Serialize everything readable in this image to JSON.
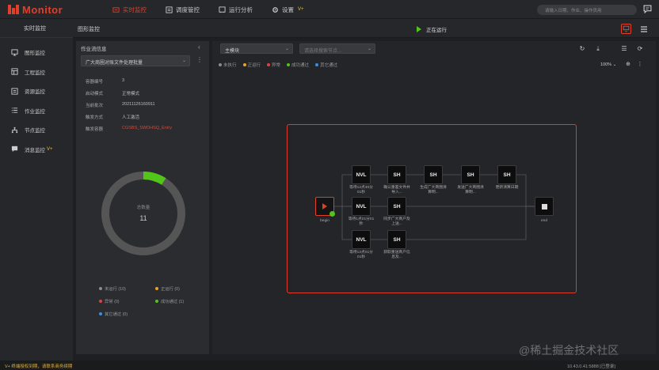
{
  "app": {
    "title": "Monitor"
  },
  "nav": [
    {
      "label": "实时监控",
      "badge": ""
    },
    {
      "label": "调度管控",
      "badge": ""
    },
    {
      "label": "运行分析",
      "badge": ""
    },
    {
      "label": "设置",
      "badge": "V+"
    }
  ],
  "search": {
    "placeholder": "请输入日期、作业、操作员用"
  },
  "sidebar": {
    "header": "实时监控",
    "items": [
      {
        "label": "图形监控",
        "icon": "monitor-icon",
        "badge": ""
      },
      {
        "label": "工程监控",
        "icon": "project-icon",
        "badge": ""
      },
      {
        "label": "资源监控",
        "icon": "resource-icon",
        "badge": ""
      },
      {
        "label": "作业监控",
        "icon": "list-icon",
        "badge": ""
      },
      {
        "label": "节点监控",
        "icon": "node-tree-icon",
        "badge": ""
      },
      {
        "label": "消息监控",
        "icon": "message-icon",
        "badge": "V+"
      }
    ]
  },
  "page": {
    "title": "图形监控",
    "status": "正在运行"
  },
  "info": {
    "title": "作业流信息",
    "flow_select": "广大商圈对账文件处理批量",
    "fields": [
      {
        "key": "容器编号",
        "value": "3",
        "red": false
      },
      {
        "key": "启动模式",
        "value": "正常模式",
        "red": false
      },
      {
        "key": "当前批次",
        "value": "20211126160911",
        "red": false
      },
      {
        "key": "触发方式",
        "value": "人工激活",
        "red": false
      },
      {
        "key": "触发容器",
        "value": "CGSBS_SWDHSQ_Entry",
        "red": true
      }
    ],
    "total_label": "总数量",
    "total": "11",
    "legend": [
      {
        "label": "未运行 (10)",
        "color": "#8c8c8c"
      },
      {
        "label": "正运行 (0)",
        "color": "#f0a020"
      },
      {
        "label": "异常 (0)",
        "color": "#e04040"
      },
      {
        "label": "成功通过 (1)",
        "color": "#52c41a"
      },
      {
        "label": "其它通过 (0)",
        "color": "#3a8ee6"
      }
    ],
    "ring": {
      "done_fraction": 0.09
    }
  },
  "canvas": {
    "module_select": "主模块",
    "node_select_placeholder": "请选择搜索节点...",
    "zoom": "100%",
    "status_legend": [
      {
        "label": "未执行",
        "color": "#8c8c8c"
      },
      {
        "label": "正运行",
        "color": "#f0a020"
      },
      {
        "label": "异常",
        "color": "#e04040"
      },
      {
        "label": "成功通过",
        "color": "#52c41a"
      },
      {
        "label": "其它通过",
        "color": "#3a8ee6"
      }
    ]
  },
  "graph": {
    "begin": "begin",
    "end": "end",
    "nodes": [
      {
        "type": "NVL",
        "label": "等待12点30分01秒"
      },
      {
        "type": "SH",
        "label": "确认重差文件并导入..."
      },
      {
        "type": "SH",
        "label": "生成广大商圈清算明..."
      },
      {
        "type": "SH",
        "label": "发送广大商圈清算明..."
      },
      {
        "type": "SH",
        "label": "更新清算日期"
      },
      {
        "type": "NVL",
        "label": "等待1点01分01秒"
      },
      {
        "type": "SH",
        "label": "同步广大商户及上送..."
      },
      {
        "type": "NVL",
        "label": "等待12点01分01秒"
      },
      {
        "type": "SH",
        "label": "获取重送商户信息及..."
      }
    ]
  },
  "footer": {
    "left": "V+ 终端授权到期，请联系商务续期",
    "right": "10.43.0.41:5888  [已登录]"
  },
  "watermark": "@稀土掘金技术社区"
}
